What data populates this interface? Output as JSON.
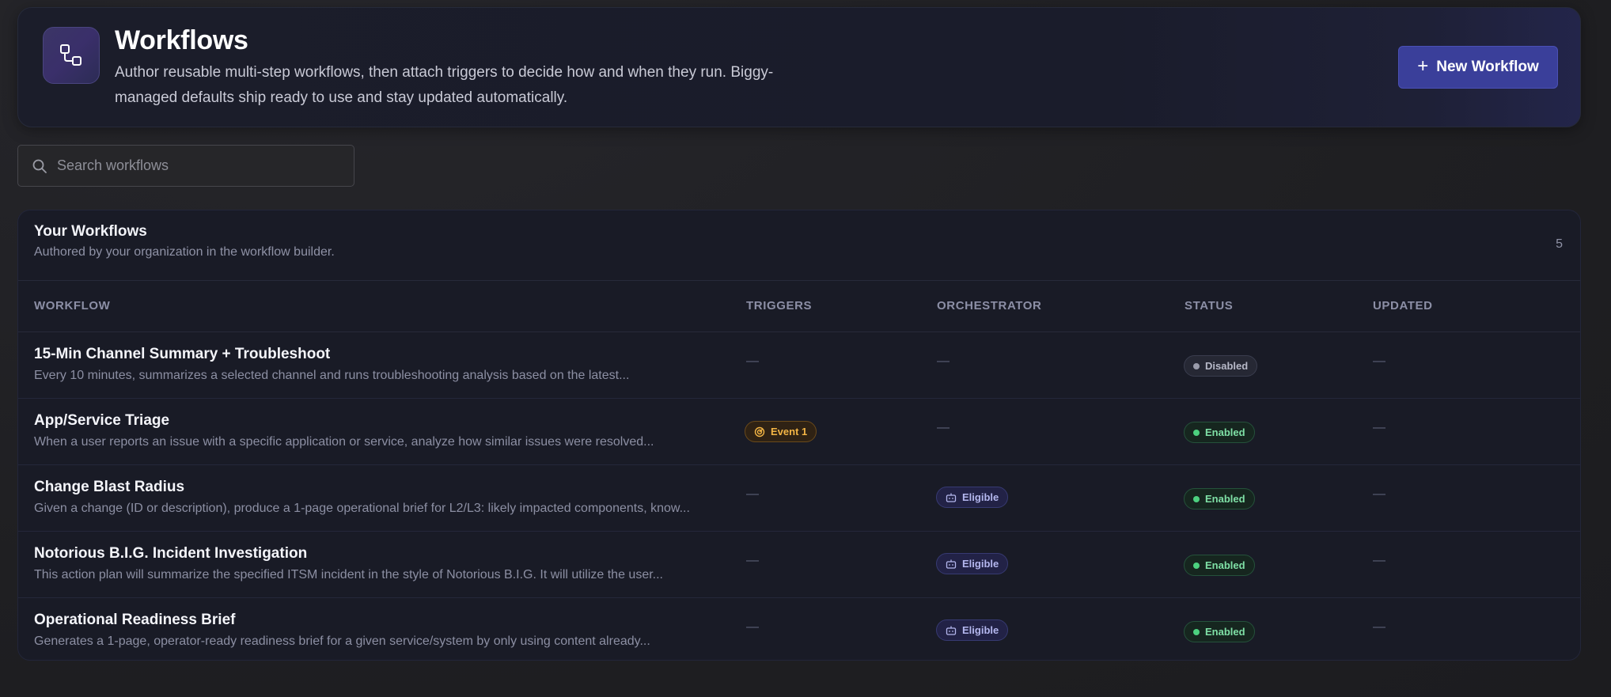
{
  "header": {
    "icon": "workflow-icon",
    "title": "Workflows",
    "subtitle": "Author reusable multi-step workflows, then attach triggers to decide how and when they run. Biggy-managed defaults ship ready to use and stay updated automatically.",
    "new_button_label": "New Workflow",
    "accent_color": "#3a3f9a"
  },
  "search": {
    "placeholder": "Search workflows",
    "value": ""
  },
  "section": {
    "title": "Your Workflows",
    "description": "Authored by your organization in the workflow builder.",
    "count": "5"
  },
  "columns": {
    "workflow": "WORKFLOW",
    "triggers": "TRIGGERS",
    "orchestrator": "ORCHESTRATOR",
    "status": "STATUS",
    "updated": "UPDATED"
  },
  "rows": [
    {
      "name": "15-Min Channel Summary + Troubleshoot",
      "description": "Every 10 minutes, summarizes a selected channel and runs troubleshooting analysis based on the latest...",
      "triggers": "—",
      "orchestrator": "—",
      "status": "Disabled",
      "updated": "—"
    },
    {
      "name": "App/Service Triage",
      "description": "When a user reports an issue with a specific application or service, analyze how similar issues were resolved...",
      "triggers": "Event 1",
      "orchestrator": "—",
      "status": "Enabled",
      "updated": "—"
    },
    {
      "name": "Change Blast Radius",
      "description": "Given a change (ID or description), produce a 1-page operational brief for L2/L3: likely impacted components, know...",
      "triggers": "—",
      "orchestrator": "Eligible",
      "status": "Enabled",
      "updated": "—"
    },
    {
      "name": "Notorious B.I.G. Incident Investigation",
      "description": "This action plan will summarize the specified ITSM incident in the style of Notorious B.I.G. It will utilize the user...",
      "triggers": "—",
      "orchestrator": "Eligible",
      "status": "Enabled",
      "updated": "—"
    },
    {
      "name": "Operational Readiness Brief",
      "description": "Generates a 1-page, operator-ready readiness brief for a given service/system by only using content already...",
      "triggers": "—",
      "orchestrator": "Eligible",
      "status": "Enabled",
      "updated": "—"
    }
  ]
}
